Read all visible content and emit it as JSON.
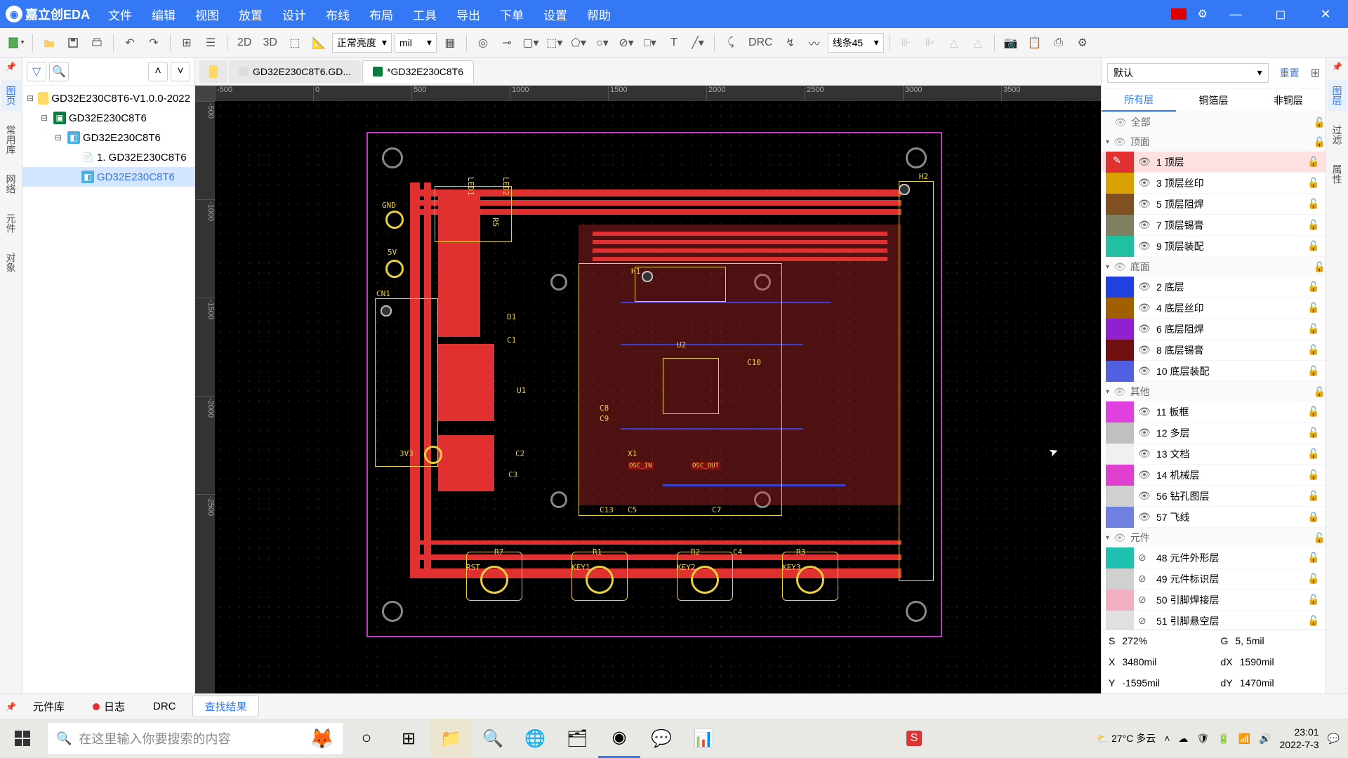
{
  "app": {
    "name": "嘉立创EDA"
  },
  "menu": [
    "文件",
    "编辑",
    "视图",
    "放置",
    "设计",
    "布线",
    "布局",
    "工具",
    "导出",
    "下单",
    "设置",
    "帮助"
  ],
  "toolbar": {
    "view2d": "2D",
    "view3d": "3D",
    "brightness": "正常亮度",
    "unit": "mil",
    "drc": "DRC",
    "route_mode": "线条45"
  },
  "tree": {
    "root": "GD32E230C8T6-V1.0.0-2022",
    "proj": "GD32E230C8T6",
    "board": "GD32E230C8T6",
    "sheet": "1. GD32E230C8T6",
    "pcb": "GD32E230C8T6"
  },
  "tabs": {
    "folder": "",
    "t1": "GD32E230C8T6.GD...",
    "t2": "*GD32E230C8T6"
  },
  "ruler_h": [
    "-500",
    "0",
    "500",
    "1000",
    "1500",
    "2000",
    "2500",
    "3000",
    "3500"
  ],
  "ruler_v": [
    "-500",
    "-1000",
    "-1500",
    "-2000",
    "-2500"
  ],
  "silkLabels": {
    "gnd": "GND",
    "5v": "5V",
    "3v3": "3V3",
    "cn1": "CN1",
    "h1": "H1",
    "h2": "H2",
    "d1": "D1",
    "c1": "C1",
    "c2": "C2",
    "c3": "C3",
    "c10": "C10",
    "c13": "C13",
    "c8": "C8",
    "c9": "C9",
    "u1": "U1",
    "u2": "U2",
    "x1": "X1",
    "r2": "R2",
    "r3": "R3",
    "r5": "R5",
    "r7": "R7",
    "r1": "R1",
    "c5": "C5",
    "c7": "C7",
    "c4": "C4",
    "rst": "RST",
    "key1": "KEY1",
    "key2": "KEY2",
    "key3": "KEY3",
    "led1": "LED1",
    "led2": "LED2",
    "osc_in": "OSC_IN",
    "osc_out": "OSC_OUT"
  },
  "rightPanel": {
    "preset": "默认",
    "reset": "重置",
    "tabs": [
      "所有层",
      "铜箔层",
      "非铜层"
    ],
    "groups": {
      "all": "全部",
      "top": "顶面",
      "bottom": "底面",
      "other": "其他",
      "comp": "元件"
    },
    "layers": [
      {
        "color": "#e03030",
        "name": "1 顶层",
        "active": true,
        "vis": true
      },
      {
        "color": "#d8a000",
        "name": "3 顶层丝印",
        "vis": true
      },
      {
        "color": "#805020",
        "name": "5 顶层阻焊",
        "vis": true
      },
      {
        "color": "#808060",
        "name": "7 顶层锡膏",
        "vis": true
      },
      {
        "color": "#20c0a0",
        "name": "9 顶层装配",
        "vis": true
      },
      {
        "color": "#2040e0",
        "name": "2 底层",
        "group": "bottom",
        "vis": true
      },
      {
        "color": "#a06000",
        "name": "4 底层丝印",
        "vis": true
      },
      {
        "color": "#9020d0",
        "name": "6 底层阻焊",
        "vis": true
      },
      {
        "color": "#701010",
        "name": "8 底层锡膏",
        "vis": true
      },
      {
        "color": "#5060e0",
        "name": "10 底层装配",
        "vis": true
      },
      {
        "color": "#e040e0",
        "name": "11 板框",
        "group": "other",
        "vis": true
      },
      {
        "color": "#c0c0c0",
        "name": "12 多层",
        "vis": true
      },
      {
        "color": "#f0f0f0",
        "name": "13 文档",
        "vis": true
      },
      {
        "color": "#e040d0",
        "name": "14 机械层",
        "vis": true
      },
      {
        "color": "#d0d0d0",
        "name": "56 钻孔图层",
        "vis": true
      },
      {
        "color": "#7080e0",
        "name": "57 飞线",
        "vis": true,
        "locked": true
      },
      {
        "color": "#20c0b0",
        "name": "48 元件外形层",
        "group": "comp",
        "vis": false
      },
      {
        "color": "#d0d0d0",
        "name": "49 元件标识层",
        "vis": false
      },
      {
        "color": "#f0b0c0",
        "name": "50 引脚焊接层",
        "vis": false
      },
      {
        "color": "#e0e0e0",
        "name": "51 引脚悬空层",
        "vis": false
      }
    ]
  },
  "status": {
    "s_label": "S",
    "s": "272%",
    "g_label": "G",
    "g": "5, 5mil",
    "x_label": "X",
    "x": "3480mil",
    "dx_label": "dX",
    "dx": "1590mil",
    "y_label": "Y",
    "y": "-1595mil",
    "dy_label": "dY",
    "dy": "1470mil"
  },
  "bottom": {
    "lib": "元件库",
    "log": "日志",
    "drc": "DRC",
    "find": "查找结果"
  },
  "rail_left": [
    "图页",
    "常用库",
    "网络",
    "元件",
    "对象"
  ],
  "rail_right": [
    "图层",
    "过滤",
    "属性"
  ],
  "taskbar": {
    "search_placeholder": "在这里输入你要搜索的内容",
    "weather": "27°C 多云",
    "time": "23:01",
    "date": "2022-7-3"
  }
}
